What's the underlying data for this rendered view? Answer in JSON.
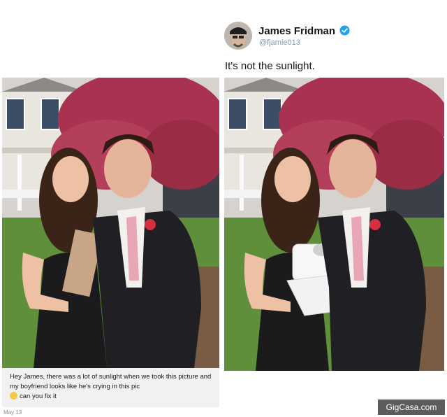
{
  "tweet": {
    "author_name": "James Fridman",
    "author_handle": "@fjamie013",
    "verified_icon": "verified-check-icon",
    "text": "It's not the sunlight."
  },
  "request": {
    "message_part1": "Hey James, there was a lot of sunlight when we took this picture and my boyfriend looks like he's crying in this pic",
    "emoji_icon": "tears-of-joy-emoji",
    "message_part2": "can you fix it",
    "date": "May 13"
  },
  "watermark": "GigCasa.com",
  "colors": {
    "verified_blue": "#1da1f2",
    "tree_blossom": "#a8324f",
    "lawn": "#5f8f3a",
    "suit": "#1f1f24",
    "dress": "#1b1b1e"
  }
}
